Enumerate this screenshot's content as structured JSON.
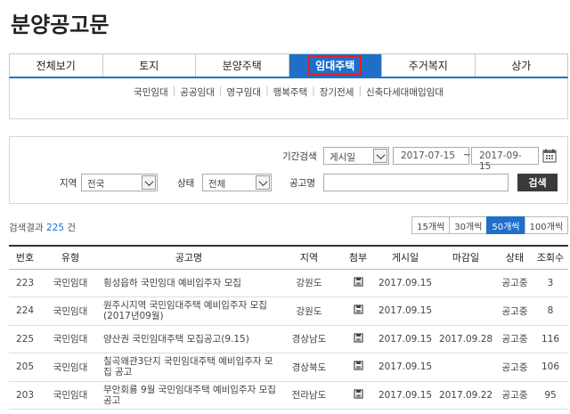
{
  "page": {
    "title": "분양공고문"
  },
  "tabs": [
    {
      "label": "전체보기",
      "active": false
    },
    {
      "label": "토지",
      "active": false
    },
    {
      "label": "분양주택",
      "active": false
    },
    {
      "label": "임대주택",
      "active": true
    },
    {
      "label": "주거복지",
      "active": false
    },
    {
      "label": "상가",
      "active": false
    }
  ],
  "subnav": [
    "국민임대",
    "공공임대",
    "영구임대",
    "행복주택",
    "장기전세",
    "신축다세대매입임대"
  ],
  "search": {
    "period_label": "기간검색",
    "period_select": "게시일",
    "date_from": "2017-07-15",
    "date_to": "2017-09-15",
    "tilde": "~",
    "region_label": "지역",
    "region_value": "전국",
    "status_label": "상태",
    "status_value": "전체",
    "name_label": "공고명",
    "name_value": "",
    "button": "검색"
  },
  "result": {
    "prefix": "검색결과",
    "count": "225",
    "suffix": "건"
  },
  "page_sizes": [
    {
      "label": "15개씩",
      "active": false
    },
    {
      "label": "30개씩",
      "active": false
    },
    {
      "label": "50개씩",
      "active": true
    },
    {
      "label": "100개씩",
      "active": false
    }
  ],
  "table": {
    "headers": [
      "번호",
      "유형",
      "공고명",
      "지역",
      "첨부",
      "게시일",
      "마감일",
      "상태",
      "조회수"
    ],
    "rows": [
      {
        "no": "223",
        "type": "국민임대",
        "title": "횡성읍하 국민임대 예비입주자 모집",
        "region": "강원도",
        "posted": "2017.09.15",
        "deadline": "",
        "status": "공고중",
        "views": "3"
      },
      {
        "no": "224",
        "type": "국민임대",
        "title": "원주시지역 국민임대주택 예비입주자 모집 (2017년09월)",
        "region": "강원도",
        "posted": "2017.09.15",
        "deadline": "",
        "status": "공고중",
        "views": "8"
      },
      {
        "no": "225",
        "type": "국민임대",
        "title": "양산권 국민임대주택 모집공고(9.15)",
        "region": "경상남도",
        "posted": "2017.09.15",
        "deadline": "2017.09.28",
        "status": "공고중",
        "views": "116"
      },
      {
        "no": "205",
        "type": "국민임대",
        "title": "칠곡왜관3단지 국민임대주택 예비입주자 모집 공고",
        "region": "경상북도",
        "posted": "2017.09.15",
        "deadline": "",
        "status": "공고중",
        "views": "106"
      },
      {
        "no": "203",
        "type": "국민임대",
        "title": "무안회룡 9월 국민임대주택 예비입주자 모집 공고",
        "region": "전라남도",
        "posted": "2017.09.15",
        "deadline": "2017.09.22",
        "status": "공고중",
        "views": "95"
      }
    ]
  },
  "icons": {
    "attachment": "file-icon",
    "calendar": "calendar-icon"
  },
  "colors": {
    "accent": "#1f6fc9",
    "highlight": "#e51c23",
    "button_dark": "#3a3a3a"
  }
}
